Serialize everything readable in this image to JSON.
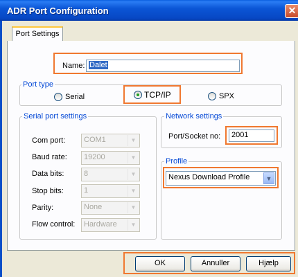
{
  "window": {
    "title": "ADR Port Configuration",
    "close_glyph": "✕"
  },
  "tabs": [
    {
      "label": "Port Settings"
    }
  ],
  "name": {
    "label": "Name:",
    "value": "Dalet"
  },
  "port_type": {
    "legend": "Port type",
    "options": [
      {
        "label": "Serial",
        "checked": false
      },
      {
        "label": "TCP/IP",
        "checked": true
      },
      {
        "label": "SPX",
        "checked": false
      }
    ]
  },
  "serial": {
    "legend": "Serial port settings",
    "com_port": {
      "label": "Com port:",
      "value": "COM1"
    },
    "baud_rate": {
      "label": "Baud rate:",
      "value": "19200"
    },
    "data_bits": {
      "label": "Data bits:",
      "value": "8"
    },
    "stop_bits": {
      "label": "Stop bits:",
      "value": "1"
    },
    "parity": {
      "label": "Parity:",
      "value": "None"
    },
    "flow_control": {
      "label": "Flow control:",
      "value": "Hardware"
    }
  },
  "network": {
    "legend": "Network settings",
    "port_label": "Port/Socket no:",
    "port_value": "2001"
  },
  "profile": {
    "legend": "Profile",
    "value": "Nexus Download Profile"
  },
  "buttons": {
    "ok": "OK",
    "cancel": "Annuller",
    "help": "Hjælp"
  },
  "icons": {
    "dropdown": "chevron-down-icon",
    "close": "close-icon"
  },
  "colors": {
    "highlight": "#f07830",
    "titlebar": "#0b56d6",
    "selection": "#316ac5"
  }
}
